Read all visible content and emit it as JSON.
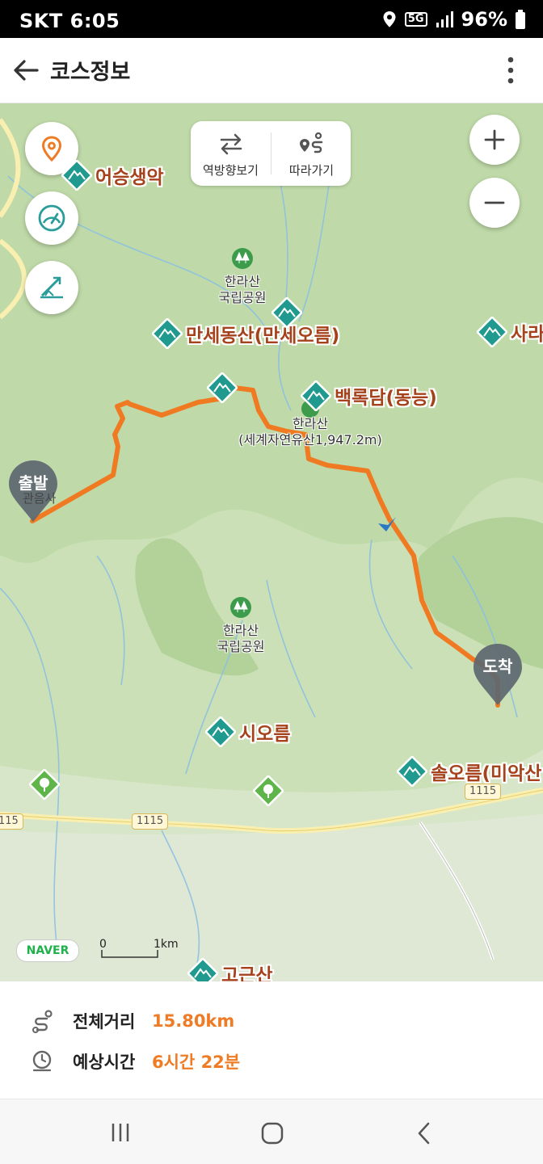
{
  "status_bar": {
    "carrier": "SKT",
    "time": "6:05",
    "network": "5G",
    "battery": "96%"
  },
  "app_bar": {
    "title": "코스정보"
  },
  "map": {
    "controls": {
      "reverse_label": "역방향보기",
      "follow_label": "따라가기"
    },
    "pois": [
      {
        "name": "어승생악"
      },
      {
        "name": "만세동산(만세오름)"
      },
      {
        "name": "백록담(동능)"
      },
      {
        "name": "사라"
      },
      {
        "name": "시오름"
      },
      {
        "name": "솔오름(미악산"
      },
      {
        "name": "고근산"
      }
    ],
    "parks": [
      {
        "line1": "한라산",
        "line2": "국립공원"
      },
      {
        "line1": "한라산",
        "line2": "국립공원"
      }
    ],
    "summit": {
      "line1": "한라산",
      "line2": "(세계자연유산1,947.2m)"
    },
    "start_marker": "출발",
    "start_label": "관음사",
    "end_marker": "도착",
    "roads": [
      "1115",
      "1115",
      "115",
      "1115"
    ],
    "naver_logo": "NAVER",
    "scale": {
      "zero": "0",
      "end": "1km"
    },
    "route_color": "#f07a22"
  },
  "course_info": {
    "distance_label": "전체거리",
    "distance_value": "15.80km",
    "time_label": "예상시간",
    "time_value": "6시간 22분"
  },
  "accent_color": "#ef7b24"
}
